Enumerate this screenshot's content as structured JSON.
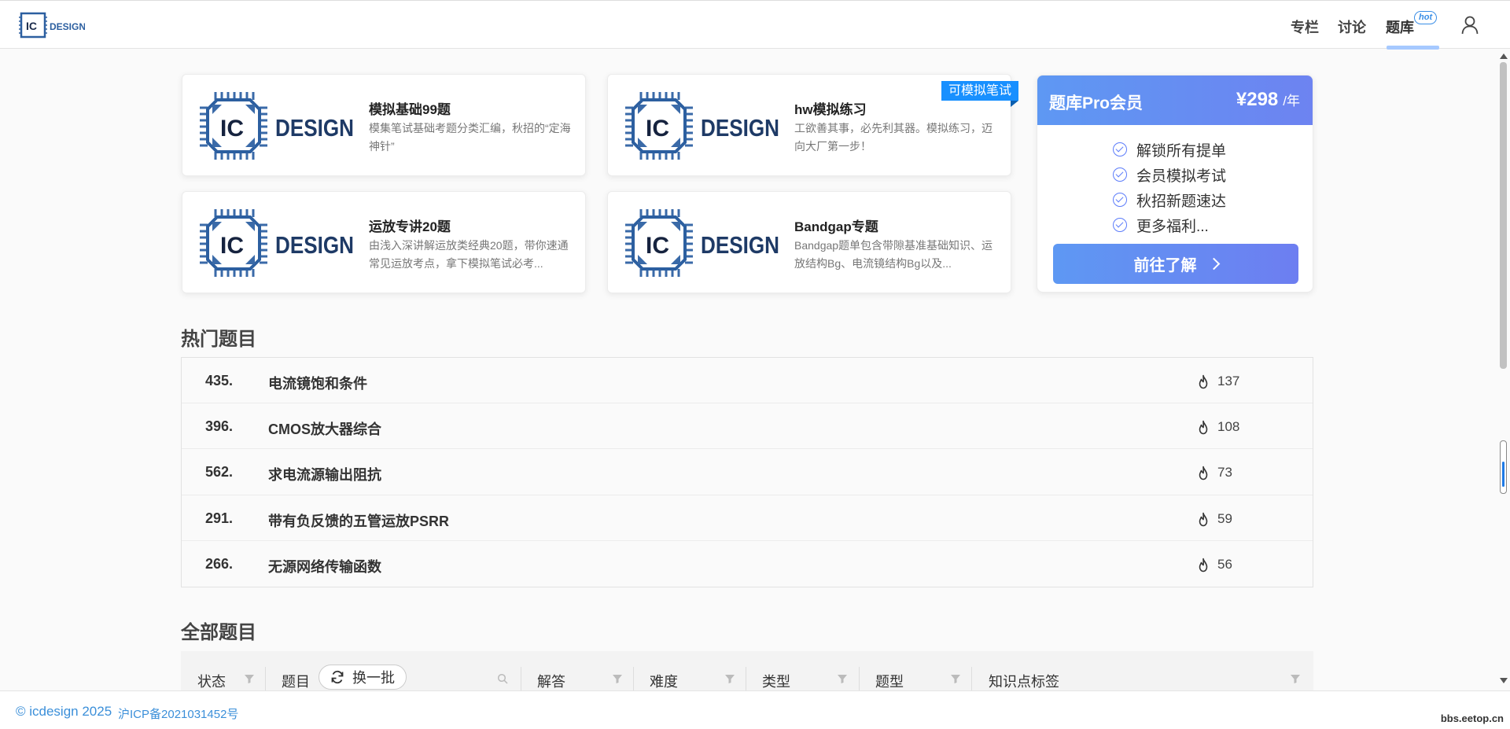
{
  "header": {
    "logo_text": "IC DESIGN",
    "nav": [
      {
        "label": "专栏"
      },
      {
        "label": "讨论"
      },
      {
        "label": "题库",
        "badge": "hot"
      }
    ]
  },
  "cards": [
    {
      "title": "模拟基础99题",
      "desc": "模集笔试基础考题分类汇编，秋招的“定海神针”",
      "logo": "IC DESIGN"
    },
    {
      "title": "hw模拟练习",
      "desc": "工欲善其事，必先利其器。模拟练习，迈向大厂第一步！",
      "ribbon": "可模拟笔试",
      "logo": "IC DESIGN"
    },
    {
      "title": "运放专讲20题",
      "desc": "由浅入深讲解运放类经典20题，带你速通常见运放考点，拿下模拟笔试必考...",
      "logo": "IC DESIGN"
    },
    {
      "title": "Bandgap专题",
      "desc": "Bandgap题单包含带隙基准基础知识、运放结构Bg、电流镜结构Bg以及...",
      "logo": "IC DESIGN"
    }
  ],
  "pro": {
    "title": "题库Pro会员",
    "price": "¥298",
    "unit": "/年",
    "features": [
      "解锁所有提单",
      "会员模拟考试",
      "秋招新题速达",
      "更多福利..."
    ],
    "button": "前往了解"
  },
  "hot": {
    "title": "热门题目",
    "rows": [
      {
        "num": "435.",
        "title": "电流镜饱和条件",
        "count": "137"
      },
      {
        "num": "396.",
        "title": "CMOS放大器综合",
        "count": "108"
      },
      {
        "num": "562.",
        "title": "求电流源输出阻抗",
        "count": "73"
      },
      {
        "num": "291.",
        "title": "带有负反馈的五管运放PSRR",
        "count": "59"
      },
      {
        "num": "266.",
        "title": "无源网络传输函数",
        "count": "56"
      }
    ]
  },
  "all": {
    "title": "全部题目",
    "columns": [
      "状态",
      "题目",
      "解答",
      "难度",
      "类型",
      "题型",
      "知识点标签"
    ],
    "swap_button": "换一批"
  },
  "footer": {
    "copyright": "© icdesign 2025",
    "icp": "沪ICP备2021031452号",
    "watermark": "bbs.eetop.cn"
  },
  "colors": {
    "accent": "#1890ff",
    "pro_gradient_start": "#5e98f3",
    "pro_gradient_end": "#6d83f1",
    "link": "#3b8fd9"
  },
  "icons": [
    "user-icon",
    "fire-icon",
    "filter-icon",
    "search-icon",
    "refresh-icon",
    "check-circle-icon",
    "chevron-right-icon"
  ]
}
